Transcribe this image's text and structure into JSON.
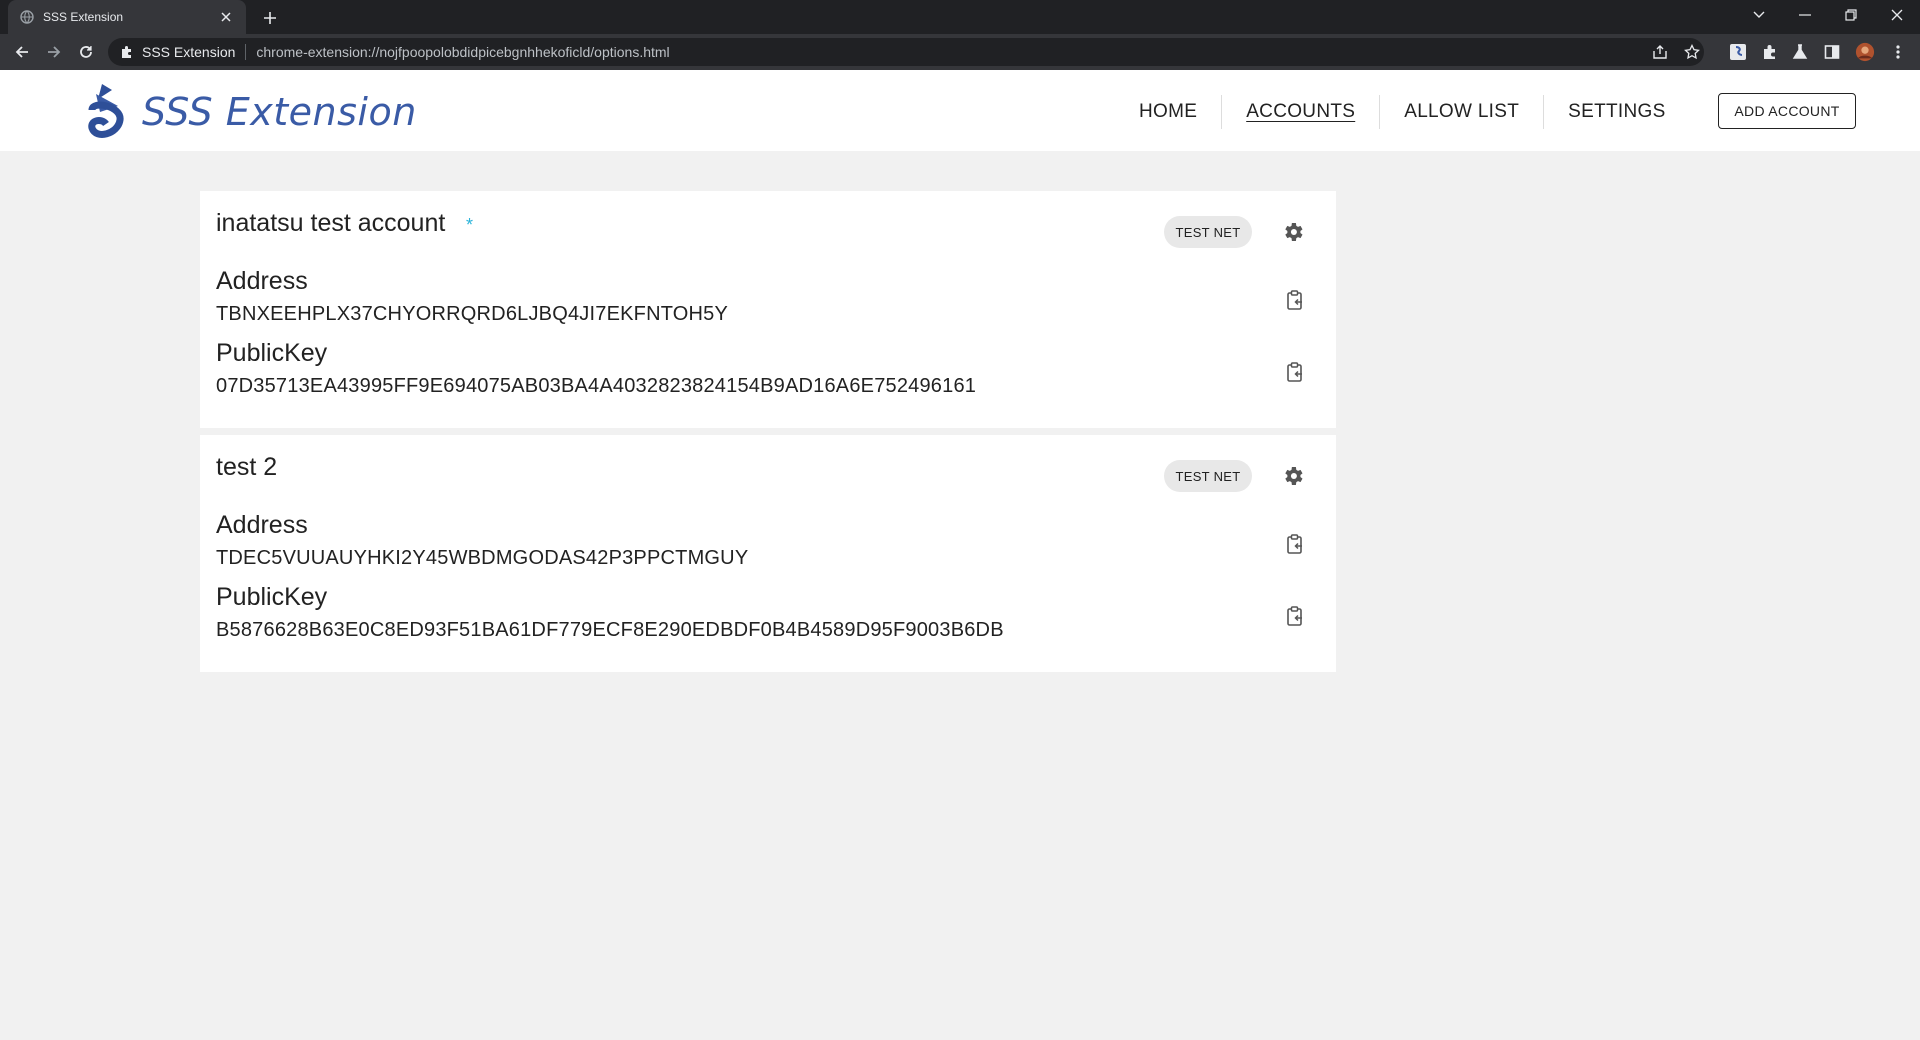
{
  "browser": {
    "tab_title": "SSS Extension",
    "omnibox_site": "SSS Extension",
    "omnibox_url": "chrome-extension://nojfpoopolobdidpicebgnhhekoficld/options.html"
  },
  "header": {
    "brand": "SSS Extension",
    "nav": [
      "HOME",
      "ACCOUNTS",
      "ALLOW LIST",
      "SETTINGS"
    ],
    "active_nav": "ACCOUNTS",
    "add_account_label": "ADD ACCOUNT"
  },
  "accounts": [
    {
      "name": "inatatsu test account",
      "is_active": true,
      "star": "*",
      "network": "TEST NET",
      "address_label": "Address",
      "address": "TBNXEEHPLX37CHYORRQRD6LJBQ4JI7EKFNTOH5Y",
      "pubkey_label": "PublicKey",
      "pubkey": "07D35713EA43995FF9E694075AB03BA4A4032823824154B9AD16A6E752496161"
    },
    {
      "name": "test 2",
      "is_active": false,
      "network": "TEST NET",
      "address_label": "Address",
      "address": "TDEC5VUUAUYHKI2Y45WBDMGODAS42P3PPCTMGUY",
      "pubkey_label": "PublicKey",
      "pubkey": "B5876628B63E0C8ED93F51BA61DF779ECF8E290EDBDF0B4B4589D95F9003B6DB"
    }
  ],
  "colors": {
    "brand": "#3a5ba6",
    "accent_star": "#2ab3d9",
    "page_bg": "#f1f1f1"
  }
}
